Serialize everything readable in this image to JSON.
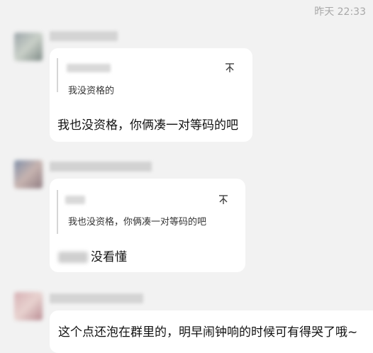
{
  "timestamp": "昨天 22:33",
  "messages": [
    {
      "avatar": "avatar",
      "quote": "我没资格的",
      "pin_icon": "pin-icon",
      "text": "我也没资格，你俩凑一对等码的吧"
    },
    {
      "avatar": "avatar",
      "quote": "我也没资格，你俩凑一对等码的吧",
      "pin_icon": "pin-icon",
      "text": "没看懂"
    },
    {
      "avatar": "avatar",
      "text": "这个点还泡在群里的，明早闹钟响的时候可有得哭了哦~"
    }
  ],
  "colors": {
    "background": "#f2f2f2",
    "bubble": "#ffffff",
    "timestamp": "#a8a8a8"
  }
}
